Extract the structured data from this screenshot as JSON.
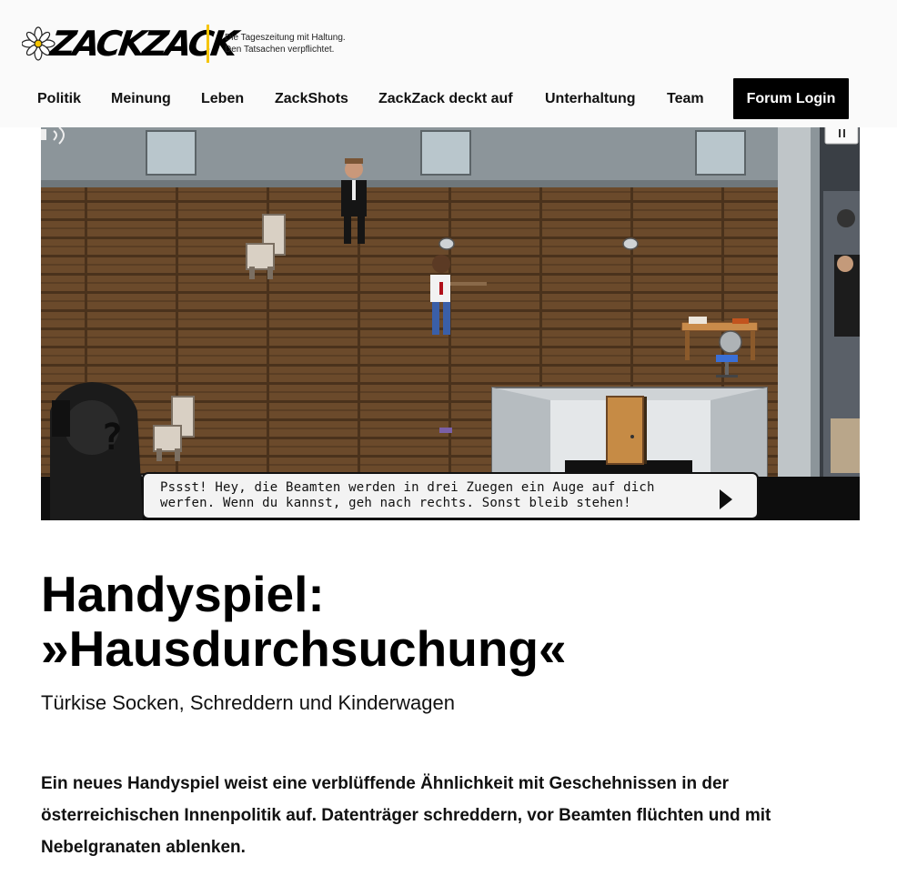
{
  "brand": {
    "logo_text": "ZACKZACK",
    "tagline_line1": "Die Tageszeitung mit Haltung.",
    "tagline_line2": "Den Tatsachen verpflichtet.",
    "accent_color": "#f5c400"
  },
  "nav": {
    "items": [
      {
        "label": "Politik"
      },
      {
        "label": "Meinung"
      },
      {
        "label": "Leben"
      },
      {
        "label": "ZackShots"
      },
      {
        "label": "ZackZack deckt auf"
      },
      {
        "label": "Unterhaltung"
      },
      {
        "label": "Team"
      }
    ],
    "forum_login": "Forum Login"
  },
  "game": {
    "dialog_line1": "Pssst! Hey, die Beamten werden in drei Zuegen ein Auge auf dich",
    "dialog_line2": "werfen. Wenn du kannst, geh nach rechts. Sonst bleib stehen!",
    "speaker_mark": "?",
    "pause_icon": "pause-icon",
    "sound_icon": "sound-icon",
    "next_icon": "play-arrow-icon"
  },
  "article": {
    "title_line1": "Handyspiel:",
    "title_line2": "»Hausdurchsuchung«",
    "subtitle": "Türkise Socken, Schreddern und Kinderwagen",
    "lead": "Ein neues Handyspiel weist eine verblüffende Ähnlichkeit mit Geschehnissen in der österreichischen Innenpolitik auf. Datenträger schreddern, vor Beamten flüchten und mit Nebelgranaten ablenken."
  }
}
